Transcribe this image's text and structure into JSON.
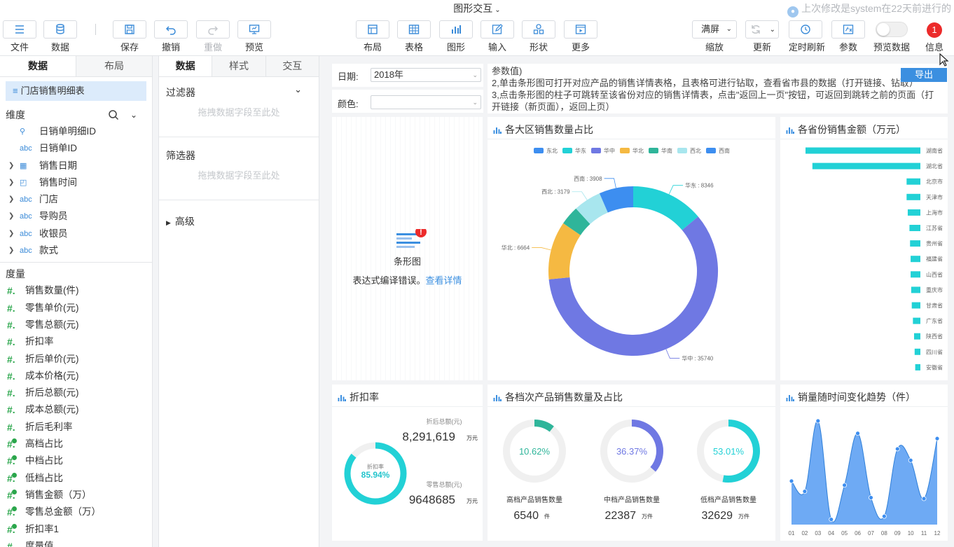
{
  "header": {
    "title": "图形交互",
    "last_modified": "上次修改是system在22天前进行的"
  },
  "toolbar": {
    "file": "文件",
    "data": "数据",
    "save": "保存",
    "undo": "撤销",
    "redo": "重做",
    "preview": "预览",
    "layout": "布局",
    "table": "表格",
    "chart": "图形",
    "input": "输入",
    "shape": "形状",
    "more": "更多",
    "zoom_value": "满屏",
    "zoom": "缩放",
    "refresh": "更新",
    "timed_refresh": "定时刷新",
    "params": "参数",
    "preview_data": "预览数据",
    "info": "信息",
    "info_count": "1"
  },
  "left_panel": {
    "tabs": [
      "数据",
      "布局"
    ],
    "dataset": "门店销售明细表",
    "dimension_title": "维度",
    "dimensions": [
      {
        "icon": "key",
        "name": "日销单明细ID",
        "expandable": false
      },
      {
        "icon": "abc",
        "name": "日销单ID",
        "expandable": false
      },
      {
        "icon": "calendar",
        "name": "销售日期",
        "expandable": true
      },
      {
        "icon": "clock",
        "name": "销售时间",
        "expandable": true
      },
      {
        "icon": "abc",
        "name": "门店",
        "expandable": true
      },
      {
        "icon": "abc",
        "name": "导购员",
        "expandable": true
      },
      {
        "icon": "abc",
        "name": "收银员",
        "expandable": true
      },
      {
        "icon": "abc",
        "name": "款式",
        "expandable": true
      }
    ],
    "measure_title": "度量",
    "measures": [
      {
        "name": "销售数量(件)",
        "calc": false
      },
      {
        "name": "零售单价(元)",
        "calc": false
      },
      {
        "name": "零售总额(元)",
        "calc": false
      },
      {
        "name": "折扣率",
        "calc": false
      },
      {
        "name": "折后单价(元)",
        "calc": false
      },
      {
        "name": "成本价格(元)",
        "calc": false
      },
      {
        "name": "折后总额(元)",
        "calc": false
      },
      {
        "name": "成本总额(元)",
        "calc": false
      },
      {
        "name": "折后毛利率",
        "calc": false
      },
      {
        "name": "高档占比",
        "calc": true
      },
      {
        "name": "中档占比",
        "calc": true
      },
      {
        "name": "低档占比",
        "calc": true
      },
      {
        "name": "销售金额（万）",
        "calc": true
      },
      {
        "name": "零售总金额（万）",
        "calc": true
      },
      {
        "name": "折扣率1",
        "calc": true
      },
      {
        "name": "度量值",
        "calc": false
      }
    ]
  },
  "mid_panel": {
    "tabs": [
      "数据",
      "样式",
      "交互"
    ],
    "filter_title": "过滤器",
    "filter_placeholder": "拖拽数据字段至此处",
    "selector_title": "筛选器",
    "selector_placeholder": "拖拽数据字段至此处",
    "advanced_title": "高级"
  },
  "canvas": {
    "date_label": "日期:",
    "date_value": "2018年",
    "color_label": "颜色:",
    "color_value": "",
    "param_lines": [
      "参数值)",
      "2,单击条形图可打开对应产品的销售详情表格，且表格可进行钻取，查看省市县的数据（打开链接、钻取）",
      "3,点击条形图的柱子可跳转至该省份对应的销售详情表，点击\"返回上一页\"按钮，可返回到跳转之前的页面（打",
      "开链接（新页面），返回上页）"
    ],
    "export_label": "导出",
    "error_widget": {
      "name": "条形图",
      "message": "表达式编译错误。",
      "link": "查看详情"
    }
  },
  "chart_data": [
    {
      "type": "pie",
      "title": "各大区销售数量占比",
      "categories": [
        "东北",
        "华东",
        "华中",
        "华北",
        "华南",
        "西北",
        "西南"
      ],
      "values": [
        0,
        8346,
        35740,
        6664,
        2200,
        3179,
        3908
      ],
      "colors": [
        "#3d8ef0",
        "#22d1d6",
        "#6f78e3",
        "#f5b942",
        "#2fb59a",
        "#a8e6ee",
        "#3d8ef0"
      ],
      "labels": [
        "",
        "华东 : 8346",
        "华中 : 35740",
        "华北 : 6664",
        "",
        "西北 : 3179",
        "西南 : 3908"
      ],
      "legend": "top"
    },
    {
      "type": "bar",
      "title": "各省份销售金额（万元）",
      "orientation": "horizontal",
      "categories": [
        "湖南省",
        "湖北省",
        "北京市",
        "天津市",
        "上海市",
        "江苏省",
        "贵州省",
        "福建省",
        "山西省",
        "重庆市",
        "甘肃省",
        "广东省",
        "陕西省",
        "四川省",
        "安徽省"
      ],
      "values": [
        100,
        94,
        12,
        12,
        11,
        9.5,
        9,
        8.5,
        8.5,
        8,
        7.5,
        6.5,
        5.5,
        5,
        4.5
      ],
      "color": "#22d1d6"
    },
    {
      "type": "gauge",
      "title": "折扣率",
      "gauge_label": "折扣率",
      "value": 85.94,
      "value_text": "85.94%",
      "kpis": [
        {
          "label": "折后总额(元)",
          "value": "8,291,619",
          "unit": "万元"
        },
        {
          "label": "零售总额(元)",
          "value": "9648685",
          "unit": "万元"
        }
      ]
    },
    {
      "type": "gauge",
      "title": "各档次产品销售数量及占比",
      "items": [
        {
          "percent": 10.62,
          "text": "10.62%",
          "label": "高档产品销售数量",
          "value": "6540",
          "unit": "件",
          "color": "#2fb59a"
        },
        {
          "percent": 36.37,
          "text": "36.37%",
          "label": "中档产品销售数量",
          "value": "22387",
          "unit": "万件",
          "color": "#6f78e3"
        },
        {
          "percent": 53.01,
          "text": "53.01%",
          "label": "低档产品销售数量",
          "value": "32629",
          "unit": "万件",
          "color": "#22d1d6"
        }
      ]
    },
    {
      "type": "area",
      "title": "销量随时间变化趋势（件）",
      "categories": [
        "01",
        "02",
        "03",
        "04",
        "05",
        "06",
        "07",
        "08",
        "09",
        "10",
        "11",
        "12"
      ],
      "values": [
        42,
        32,
        100,
        5,
        38,
        88,
        26,
        8,
        73,
        62,
        25,
        83
      ],
      "ylim": [
        0,
        100
      ],
      "color": "#3d8ef0"
    }
  ]
}
